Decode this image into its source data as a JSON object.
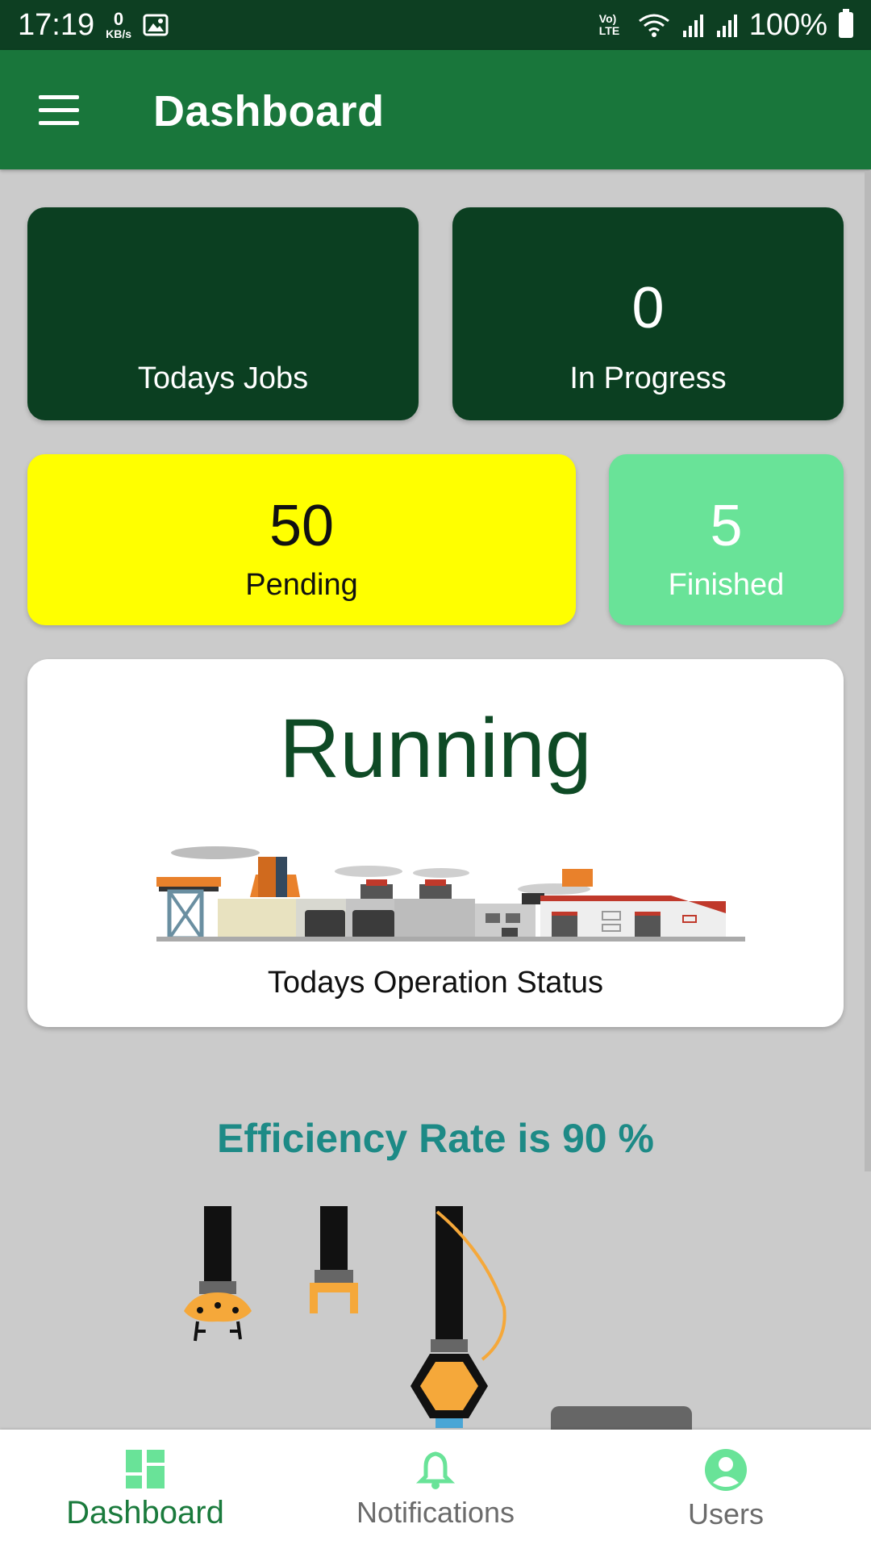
{
  "status_bar": {
    "time": "17:19",
    "net_speed_value": "0",
    "net_speed_unit": "KB/s",
    "network_type": "Vo) LTE",
    "battery": "100%"
  },
  "app_bar": {
    "title": "Dashboard"
  },
  "stats": {
    "todays_jobs": {
      "value": "",
      "label": "Todays Jobs"
    },
    "in_progress": {
      "value": "0",
      "label": "In Progress"
    },
    "pending": {
      "value": "50",
      "label": "Pending"
    },
    "finished": {
      "value": "5",
      "label": "Finished"
    }
  },
  "operation": {
    "status": "Running",
    "caption": "Todays Operation Status"
  },
  "efficiency": {
    "text": "Efficiency Rate is 90 %"
  },
  "bottom_nav": {
    "items": [
      {
        "label": "Dashboard",
        "active": true
      },
      {
        "label": "Notifications"
      },
      {
        "label": "Users"
      }
    ]
  },
  "colors": {
    "app_bar": "#19763b",
    "status_bar": "#0d3f22",
    "card_dark": "#0b3f21",
    "pending": "#ffff00",
    "finished": "#69e398",
    "efficiency_text": "#1d8a86",
    "nav_active": "#1a7a3c",
    "nav_icon": "#69e398"
  }
}
